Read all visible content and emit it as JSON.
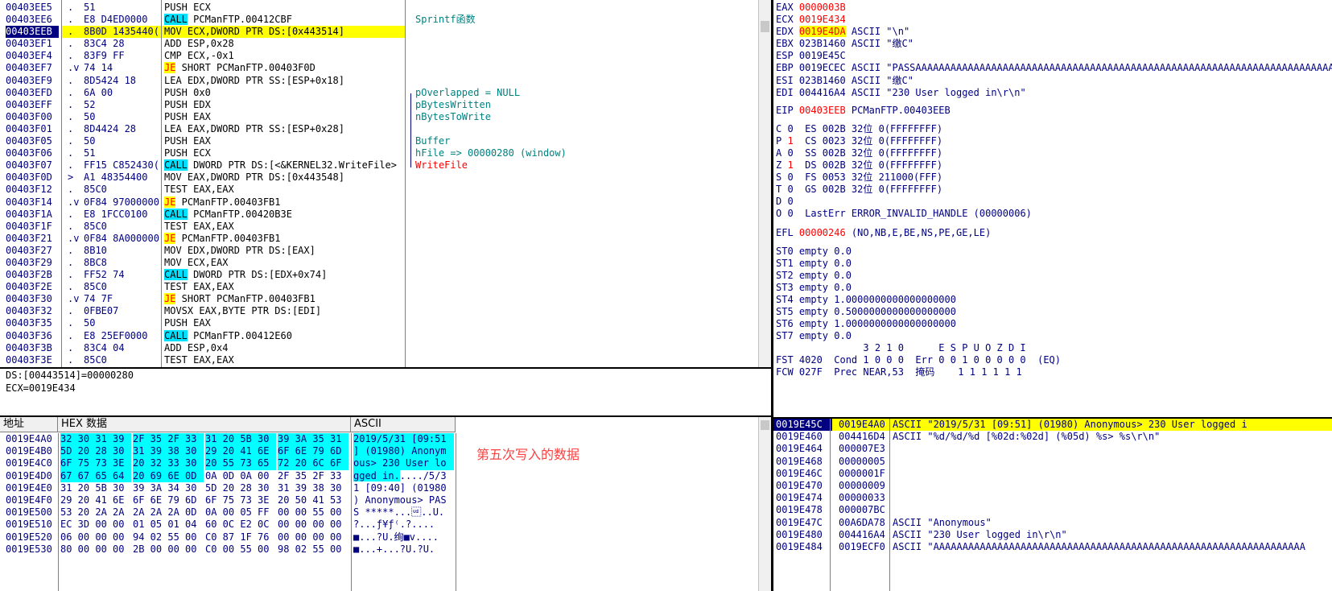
{
  "disasm": {
    "rows": [
      {
        "addr": "00403EE5",
        "m": ".",
        "hex": "51",
        "op": [
          {
            "t": "PUSH ECX"
          }
        ],
        "cmt": ""
      },
      {
        "addr": "00403EE6",
        "m": ".",
        "hex": "E8 D4ED0000",
        "op": [
          {
            "t": "CALL",
            "c": "call"
          },
          {
            "t": " PCManFTP.00412CBF"
          }
        ],
        "cmt": "Sprintf函数"
      },
      {
        "addr": "00403EEB",
        "m": ".",
        "hex": "8B0D 1435440(",
        "op": [
          {
            "t": "MOV ECX,DWORD PTR DS:[0x443514]"
          }
        ],
        "cmt": "",
        "cur": true
      },
      {
        "addr": "00403EF1",
        "m": ".",
        "hex": "83C4 28",
        "op": [
          {
            "t": "ADD ESP,0x28"
          }
        ],
        "cmt": ""
      },
      {
        "addr": "00403EF4",
        "m": ".",
        "hex": "83F9 FF",
        "op": [
          {
            "t": "CMP ECX,-0x1"
          }
        ],
        "cmt": ""
      },
      {
        "addr": "00403EF7",
        "m": ".v",
        "hex": "74 14",
        "op": [
          {
            "t": "JE",
            "c": "je"
          },
          {
            "t": " SHORT PCManFTP.00403F0D"
          }
        ],
        "cmt": ""
      },
      {
        "addr": "00403EF9",
        "m": ".",
        "hex": "8D5424 18",
        "op": [
          {
            "t": "LEA EDX,DWORD PTR SS:[ESP+0x18]"
          }
        ],
        "cmt": ""
      },
      {
        "addr": "00403EFD",
        "m": ".",
        "hex": "6A 00",
        "op": [
          {
            "t": "PUSH 0x0"
          }
        ],
        "cmt": "pOverlapped = NULL"
      },
      {
        "addr": "00403EFF",
        "m": ".",
        "hex": "52",
        "op": [
          {
            "t": "PUSH EDX"
          }
        ],
        "cmt": "pBytesWritten"
      },
      {
        "addr": "00403F00",
        "m": ".",
        "hex": "50",
        "op": [
          {
            "t": "PUSH EAX"
          }
        ],
        "cmt": "nBytesToWrite"
      },
      {
        "addr": "00403F01",
        "m": ".",
        "hex": "8D4424 28",
        "op": [
          {
            "t": "LEA EAX,DWORD PTR SS:[ESP+0x28]"
          }
        ],
        "cmt": ""
      },
      {
        "addr": "00403F05",
        "m": ".",
        "hex": "50",
        "op": [
          {
            "t": "PUSH EAX"
          }
        ],
        "cmt": "Buffer"
      },
      {
        "addr": "00403F06",
        "m": ".",
        "hex": "51",
        "op": [
          {
            "t": "PUSH ECX"
          }
        ],
        "cmt": "hFile => 00000280 (window)"
      },
      {
        "addr": "00403F07",
        "m": ".",
        "hex": "FF15 C852430(",
        "op": [
          {
            "t": "CALL",
            "c": "call"
          },
          {
            "t": " DWORD PTR DS:[<&KERNEL32.WriteFile>"
          }
        ],
        "cmt": "WriteFile",
        "cmtRed": true
      },
      {
        "addr": "00403F0D",
        "m": ">",
        "hex": "A1 48354400",
        "op": [
          {
            "t": "MOV EAX,DWORD PTR DS:[0x443548]"
          }
        ],
        "cmt": ""
      },
      {
        "addr": "00403F12",
        "m": ".",
        "hex": "85C0",
        "op": [
          {
            "t": "TEST EAX,EAX"
          }
        ],
        "cmt": ""
      },
      {
        "addr": "00403F14",
        "m": ".v",
        "hex": "0F84 97000000",
        "op": [
          {
            "t": "JE",
            "c": "je"
          },
          {
            "t": " PCManFTP.00403FB1"
          }
        ],
        "cmt": ""
      },
      {
        "addr": "00403F1A",
        "m": ".",
        "hex": "E8 1FCC0100",
        "op": [
          {
            "t": "CALL",
            "c": "call"
          },
          {
            "t": " PCManFTP.00420B3E"
          }
        ],
        "cmt": ""
      },
      {
        "addr": "00403F1F",
        "m": ".",
        "hex": "85C0",
        "op": [
          {
            "t": "TEST EAX,EAX"
          }
        ],
        "cmt": ""
      },
      {
        "addr": "00403F21",
        "m": ".v",
        "hex": "0F84 8A000000",
        "op": [
          {
            "t": "JE",
            "c": "je"
          },
          {
            "t": " PCManFTP.00403FB1"
          }
        ],
        "cmt": ""
      },
      {
        "addr": "00403F27",
        "m": ".",
        "hex": "8B10",
        "op": [
          {
            "t": "MOV EDX,DWORD PTR DS:[EAX]"
          }
        ],
        "cmt": ""
      },
      {
        "addr": "00403F29",
        "m": ".",
        "hex": "8BC8",
        "op": [
          {
            "t": "MOV ECX,EAX"
          }
        ],
        "cmt": ""
      },
      {
        "addr": "00403F2B",
        "m": ".",
        "hex": "FF52 74",
        "op": [
          {
            "t": "CALL",
            "c": "call"
          },
          {
            "t": " DWORD PTR DS:[EDX+0x74]"
          }
        ],
        "cmt": ""
      },
      {
        "addr": "00403F2E",
        "m": ".",
        "hex": "85C0",
        "op": [
          {
            "t": "TEST EAX,EAX"
          }
        ],
        "cmt": ""
      },
      {
        "addr": "00403F30",
        "m": ".v",
        "hex": "74 7F",
        "op": [
          {
            "t": "JE",
            "c": "je"
          },
          {
            "t": " SHORT PCManFTP.00403FB1"
          }
        ],
        "cmt": ""
      },
      {
        "addr": "00403F32",
        "m": ".",
        "hex": "0FBE07",
        "op": [
          {
            "t": "MOVSX EAX,BYTE PTR DS:[EDI]"
          }
        ],
        "cmt": ""
      },
      {
        "addr": "00403F35",
        "m": ".",
        "hex": "50",
        "op": [
          {
            "t": "PUSH EAX"
          }
        ],
        "cmt": ""
      },
      {
        "addr": "00403F36",
        "m": ".",
        "hex": "E8 25EF0000",
        "op": [
          {
            "t": "CALL",
            "c": "call"
          },
          {
            "t": " PCManFTP.00412E60"
          }
        ],
        "cmt": ""
      },
      {
        "addr": "00403F3B",
        "m": ".",
        "hex": "83C4 04",
        "op": [
          {
            "t": "ADD ESP,0x4"
          }
        ],
        "cmt": ""
      },
      {
        "addr": "00403F3E",
        "m": ".",
        "hex": "85C0",
        "op": [
          {
            "t": "TEST EAX,EAX"
          }
        ],
        "cmt": ""
      }
    ]
  },
  "info": {
    "line1": "DS:[00443514]=00000280",
    "line2": "ECX=0019E434"
  },
  "registers": {
    "gp": [
      {
        "name": "EAX",
        "val": "0000003B",
        "red": true,
        "rest": ""
      },
      {
        "name": "ECX",
        "val": "0019E434",
        "red": true,
        "rest": ""
      },
      {
        "name": "EDX",
        "val": "0019E4DA",
        "red": true,
        "hl": true,
        "rest": "ASCII \"\\n\""
      },
      {
        "name": "EBX",
        "val": "023B1460",
        "rest": "ASCII \"缴C\""
      },
      {
        "name": "ESP",
        "val": "0019E45C",
        "rest": ""
      },
      {
        "name": "EBP",
        "val": "0019ECEC",
        "rest": "ASCII \"PASSAAAAAAAAAAAAAAAAAAAAAAAAAAAAAAAAAAAAAAAAAAAAAAAAAAAAAAAAAAAAAAAAAAAAAAAAAAAAAAAA"
      },
      {
        "name": "ESI",
        "val": "023B1460",
        "rest": "ASCII \"缴C\""
      },
      {
        "name": "EDI",
        "val": "004416A4",
        "rest": "ASCII \"230 User logged in\\r\\n\""
      }
    ],
    "eip": {
      "name": "EIP",
      "val": "00403EEB",
      "rest": "PCManFTP.00403EEB"
    },
    "flags": [
      {
        "f": "C",
        "v": "0",
        "seg": "ES 002B 32位 0(FFFFFFFF)"
      },
      {
        "f": "P",
        "v": "1",
        "red": true,
        "seg": "CS 0023 32位 0(FFFFFFFF)"
      },
      {
        "f": "A",
        "v": "0",
        "seg": "SS 002B 32位 0(FFFFFFFF)"
      },
      {
        "f": "Z",
        "v": "1",
        "red": true,
        "seg": "DS 002B 32位 0(FFFFFFFF)"
      },
      {
        "f": "S",
        "v": "0",
        "seg": "FS 0053 32位 211000(FFF)"
      },
      {
        "f": "T",
        "v": "0",
        "seg": "GS 002B 32位 0(FFFFFFFF)"
      },
      {
        "f": "D",
        "v": "0",
        "seg": ""
      },
      {
        "f": "O",
        "v": "0",
        "seg": "LastErr ERROR_INVALID_HANDLE (00000006)"
      }
    ],
    "efl": {
      "name": "EFL",
      "val": "00000246",
      "rest": "(NO,NB,E,BE,NS,PE,GE,LE)"
    },
    "fpu": [
      "ST0 empty 0.0",
      "ST1 empty 0.0",
      "ST2 empty 0.0",
      "ST3 empty 0.0",
      "ST4 empty 1.0000000000000000000",
      "ST5 empty 0.5000000000000000000",
      "ST6 empty 1.0000000000000000000",
      "ST7 empty 0.0"
    ],
    "fst_head": "               3 2 1 0      E S P U O Z D I",
    "fst": "FST 4020  Cond 1 0 0 0  Err 0 0 1 0 0 0 0 0  (EQ)",
    "fcw": "FCW 027F  Prec NEAR,53  掩码    1 1 1 1 1 1"
  },
  "dump": {
    "headers": {
      "addr": "地址",
      "hex": "HEX 数据",
      "ascii": "ASCII"
    },
    "rows": [
      {
        "addr": "0019E4A0",
        "hex": [
          "32 30 31 39",
          "2F 35 2F 33",
          "31 20 5B 30",
          "39 3A 35 31"
        ],
        "sel": [
          1,
          1,
          1,
          1
        ],
        "ascii": "2019/5/31 [09:51",
        "asel": true
      },
      {
        "addr": "0019E4B0",
        "hex": [
          "5D 20 28 30",
          "31 39 38 30",
          "29 20 41 6E",
          "6F 6E 79 6D"
        ],
        "sel": [
          1,
          1,
          1,
          1
        ],
        "ascii": "] (01980) Anonym",
        "asel": true
      },
      {
        "addr": "0019E4C0",
        "hex": [
          "6F 75 73 3E",
          "20 32 33 30",
          "20 55 73 65",
          "72 20 6C 6F"
        ],
        "sel": [
          1,
          1,
          1,
          1
        ],
        "ascii": "ous> 230 User lo",
        "asel": true
      },
      {
        "addr": "0019E4D0",
        "hex": [
          "67 67 65 64",
          "20 69 6E 0D",
          "0A 0D 0A 00",
          "2F 35 2F 33"
        ],
        "sel": [
          1,
          1,
          0,
          0
        ],
        "ascii": "gged in...../5/3",
        "asel": "part"
      },
      {
        "addr": "0019E4E0",
        "hex": [
          "31 20 5B 30",
          "39 3A 34 30",
          "5D 20 28 30",
          "31 39 38 30"
        ],
        "sel": [
          0,
          0,
          0,
          0
        ],
        "ascii": "1 [09:40] (01980"
      },
      {
        "addr": "0019E4F0",
        "hex": [
          "29 20 41 6E",
          "6F 6E 79 6D",
          "6F 75 73 3E",
          "20 50 41 53"
        ],
        "sel": [
          0,
          0,
          0,
          0
        ],
        "ascii": ") Anonymous> PAS"
      },
      {
        "addr": "0019E500",
        "hex": [
          "53 20 2A 2A",
          "2A 2A 2A 0D",
          "0A 00 05 FF",
          "00 00 55 00"
        ],
        "sel": [
          0,
          0,
          0,
          0
        ],
        "ascii": "S *****...\u001f..U."
      },
      {
        "addr": "0019E510",
        "hex": [
          "EC 3D 00 00",
          "01 05 01 04",
          "60 0C E2 0C",
          "00 00 00 00"
        ],
        "sel": [
          0,
          0,
          0,
          0
        ],
        "ascii": "?...ƒ¥ƒ⁽.?...."
      },
      {
        "addr": "0019E520",
        "hex": [
          "06 00 00 00",
          "94 02 55 00",
          "C0 87 1F 76",
          "00 00 00 00"
        ],
        "sel": [
          0,
          0,
          0,
          0
        ],
        "ascii": "■...?U.绚■v...."
      },
      {
        "addr": "0019E530",
        "hex": [
          "80 00 00 00",
          "2B 00 00 00",
          "C0 00 55 00",
          "98 02 55 00"
        ],
        "sel": [
          0,
          0,
          0,
          0
        ],
        "ascii": "■...+...?U.?U."
      }
    ],
    "note": "第五次写入的数据"
  },
  "stack": {
    "rows": [
      {
        "addr": "0019E45C",
        "val": "0019E4A0",
        "cmt": "ASCII \"2019/5/31 [09:51] (01980) Anonymous> 230 User logged i",
        "top": true
      },
      {
        "addr": "0019E460",
        "val": "004416D4",
        "cmt": "ASCII \"%d/%d/%d [%02d:%02d] (%05d) %s> %s\\r\\n\""
      },
      {
        "addr": "0019E464",
        "val": "000007E3",
        "cmt": ""
      },
      {
        "addr": "0019E468",
        "val": "00000005",
        "cmt": ""
      },
      {
        "addr": "0019E46C",
        "val": "0000001F",
        "cmt": ""
      },
      {
        "addr": "0019E470",
        "val": "00000009",
        "cmt": ""
      },
      {
        "addr": "0019E474",
        "val": "00000033",
        "cmt": ""
      },
      {
        "addr": "0019E478",
        "val": "000007BC",
        "cmt": ""
      },
      {
        "addr": "0019E47C",
        "val": "00A6DA78",
        "cmt": "ASCII \"Anonymous\""
      },
      {
        "addr": "0019E480",
        "val": "004416A4",
        "cmt": "ASCII \"230 User logged in\\r\\n\""
      },
      {
        "addr": "0019E484",
        "val": "0019ECF0",
        "cmt": "ASCII \"AAAAAAAAAAAAAAAAAAAAAAAAAAAAAAAAAAAAAAAAAAAAAAAAAAAAAAAAAAAAAAAA"
      }
    ]
  },
  "colors": {
    "address_blue": "#000080",
    "comment_teal": "#008080",
    "call_bg": "#00e0ff",
    "je_bg": "#ffff00",
    "current_line": "#ffff00",
    "changed_reg": "#ff0000",
    "dump_selection": "#00ffff"
  }
}
